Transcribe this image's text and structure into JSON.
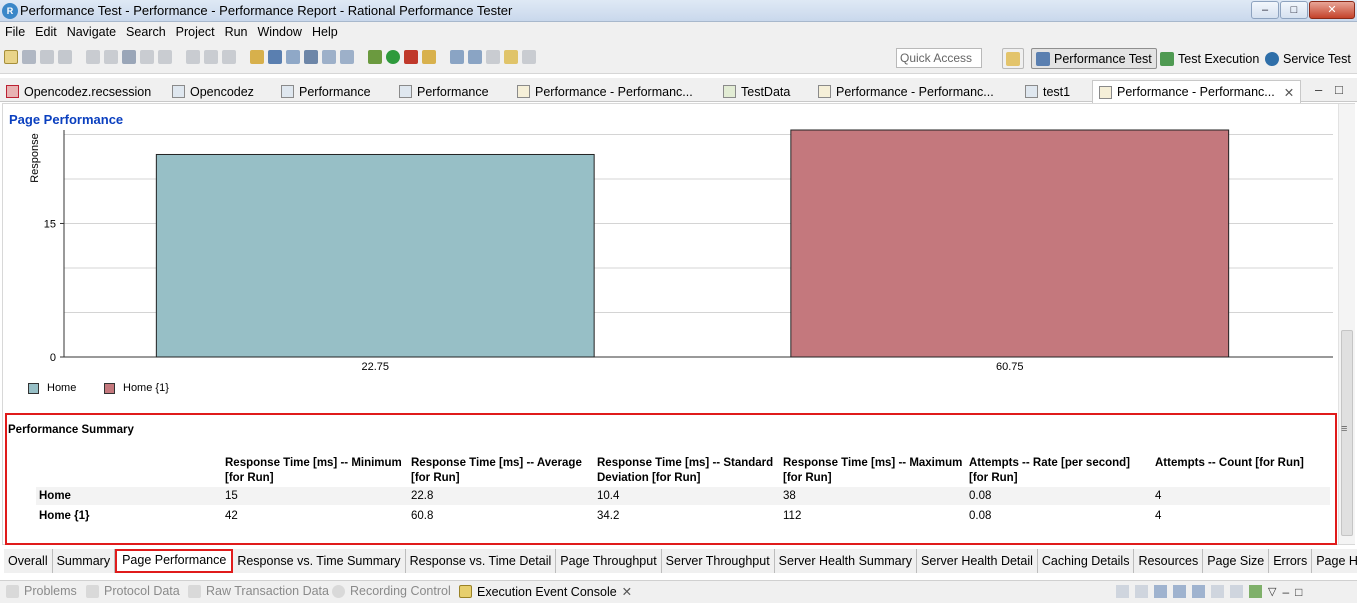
{
  "window": {
    "title": "Performance Test - Performance - Performance Report - Rational Performance Tester",
    "minimize": "–",
    "maximize": "□",
    "close": "✕"
  },
  "menu": [
    "File",
    "Edit",
    "Navigate",
    "Search",
    "Project",
    "Run",
    "Window",
    "Help"
  ],
  "toolbar": {
    "quick_access_placeholder": "Quick Access",
    "perspectives": [
      "Performance Test",
      "Test Execution",
      "Service Test"
    ]
  },
  "editor_tabs": [
    "Opencodez.recsession",
    "Opencodez",
    "Performance",
    "Performance",
    "Performance - Performanc...",
    "TestData",
    "Performance - Performanc...",
    "test1",
    "Performance - Performanc..."
  ],
  "page": {
    "heading": "Page Performance",
    "tab_minimize": "–",
    "tab_maximize": "□"
  },
  "chart_data": {
    "type": "bar",
    "categories": [
      "22.75",
      "60.75"
    ],
    "series": [
      {
        "name": "Home",
        "values": [
          22.75
        ],
        "color": "#97bfc6"
      },
      {
        "name": "Home {1}",
        "values": [
          60.75
        ],
        "color": "#c4787d"
      }
    ],
    "ylabel": "Response",
    "yticks": [
      "0",
      "15"
    ],
    "ylim_visible": [
      0,
      25.5
    ],
    "grid": true
  },
  "summary": {
    "title": "Performance Summary",
    "columns": [
      "Response Time [ms] -- Minimum [for Run]",
      "Response Time [ms] -- Average [for Run]",
      "Response Time [ms] -- Standard Deviation [for Run]",
      "Response Time [ms] -- Maximum [for Run]",
      "Attempts -- Rate [per second] [for Run]",
      "Attempts -- Count [for Run]"
    ],
    "rows": [
      {
        "label": "Home",
        "values": [
          "15",
          "22.8",
          "10.4",
          "38",
          "0.08",
          "4"
        ]
      },
      {
        "label": "Home {1}",
        "values": [
          "42",
          "60.8",
          "34.2",
          "112",
          "0.08",
          "4"
        ]
      }
    ]
  },
  "report_tabs": [
    "Overall",
    "Summary",
    "Page Performance",
    "Response vs. Time Summary",
    "Response vs. Time Detail",
    "Page Throughput",
    "Server Throughput",
    "Server Health Summary",
    "Server Health Detail",
    "Caching Details",
    "Resources",
    "Page Size",
    "Errors",
    "Page Health"
  ],
  "active_report_tab": "Page Performance",
  "bottom_views": [
    "Problems",
    "Protocol Data",
    "Raw Transaction Data",
    "Recording Control",
    "Execution Event Console"
  ],
  "colors": {
    "accent_red": "#e01b1b",
    "heading_blue": "#0a3fbf",
    "bar_home": "#97bfc6",
    "bar_home1": "#c4787d"
  }
}
